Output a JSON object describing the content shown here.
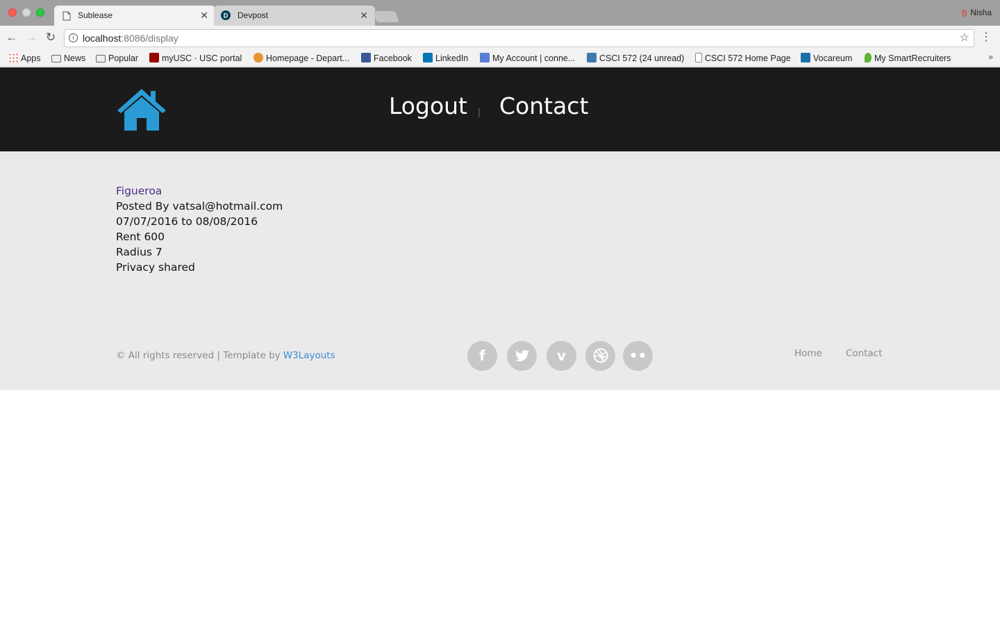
{
  "browser": {
    "tabs": [
      {
        "title": "Sublease",
        "icon": "page-icon",
        "active": true
      },
      {
        "title": "Devpost",
        "icon": "devpost-icon",
        "active": false
      }
    ],
    "close_glyph": "✕",
    "profile_name": "Nisha",
    "url_host": "localhost",
    "url_path": ":8086/display",
    "bookmarks": [
      {
        "label": "Apps",
        "icon": "apps-grid-icon"
      },
      {
        "label": "News",
        "icon": "folder-icon"
      },
      {
        "label": "Popular",
        "icon": "folder-icon"
      },
      {
        "label": "myUSC · USC portal",
        "icon": "usc-icon"
      },
      {
        "label": "Homepage - Depart...",
        "icon": "department-icon"
      },
      {
        "label": "Facebook",
        "icon": "facebook-icon"
      },
      {
        "label": "LinkedIn",
        "icon": "linkedin-icon"
      },
      {
        "label": "My Account | conne...",
        "icon": "account-icon"
      },
      {
        "label": "CSCI 572 (24 unread)",
        "icon": "piazza-icon"
      },
      {
        "label": "CSCI 572 Home Page",
        "icon": "page-icon"
      },
      {
        "label": "Vocareum",
        "icon": "vocareum-icon"
      },
      {
        "label": "My SmartRecruiters",
        "icon": "smartrecruiters-icon"
      }
    ]
  },
  "header": {
    "logo_icon": "home-icon",
    "nav": {
      "logout": "Logout",
      "separator": "|",
      "contact": "Contact"
    },
    "accent_color": "#2a9bd5"
  },
  "listing": {
    "title": "Figueroa",
    "posted_by": "Posted By vatsal@hotmail.com",
    "dates": "07/07/2016 to 08/08/2016",
    "rent": "Rent 600",
    "radius": "Radius 7",
    "privacy": "Privacy shared"
  },
  "footer": {
    "copyright": "© All rights reserved | Template by",
    "template_link": "W3Layouts",
    "social": [
      {
        "name": "facebook-icon",
        "glyph": "f"
      },
      {
        "name": "twitter-icon",
        "glyph": "🐦"
      },
      {
        "name": "vimeo-icon",
        "glyph": "v"
      },
      {
        "name": "dribbble-icon",
        "glyph": "◍"
      },
      {
        "name": "flickr-icon",
        "glyph": "••"
      }
    ],
    "links": {
      "home": "Home",
      "contact": "Contact"
    }
  }
}
